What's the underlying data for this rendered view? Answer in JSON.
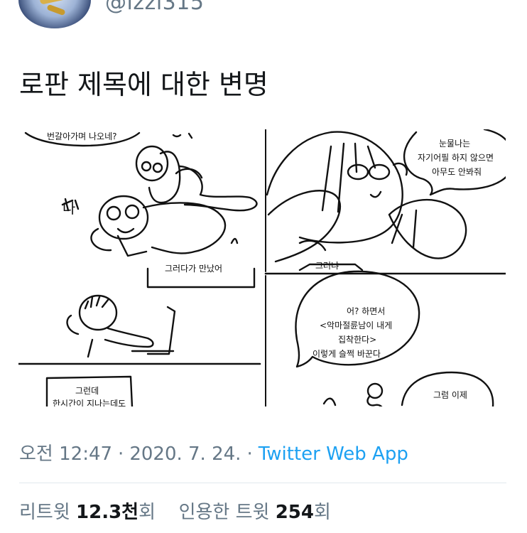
{
  "header": {
    "handle": "@izzi315"
  },
  "tweet": {
    "text": "로판 제목에 대한 변명",
    "comic": {
      "panel1_speech": "번갈아가며 나오네?",
      "panel1_sfx": "나",
      "panel1_bottom": "그러다가 만났어",
      "panel2_speech": [
        "눈물나는",
        "자기어필 하지 않으면",
        "아무도 안봐줘"
      ],
      "panel2_caption": "그러냐",
      "panel4_speech": [
        "어? 하면서",
        "<악마절륜남이 내게",
        "집착한다>",
        "이렇게 슬쩍 바꾼다"
      ],
      "panel5_caption": [
        "그런데",
        "한시간이 지나는데도"
      ],
      "panel6_speech": "그럼 이제"
    }
  },
  "meta": {
    "time": "오전 12:47",
    "date": "2020. 7. 24.",
    "separator": "·",
    "source": "Twitter Web App"
  },
  "stats": {
    "retweets_label": "리트윗",
    "retweets_value": "12.3천",
    "retweets_suffix": "회",
    "quotes_label": "인용한 트윗",
    "quotes_value": "254",
    "quotes_suffix": "회"
  }
}
